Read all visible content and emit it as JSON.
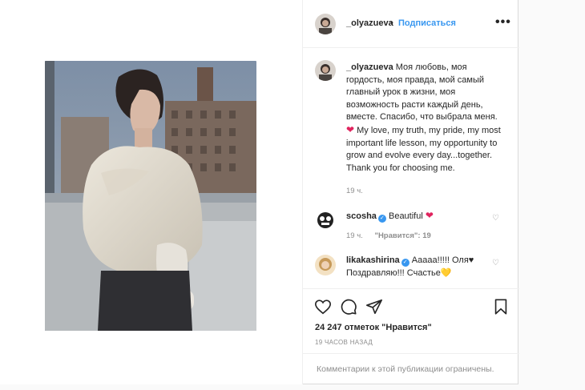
{
  "header": {
    "username": "_olyazueva",
    "dot": "•",
    "follow_label": "Подписаться",
    "more_label": "•••"
  },
  "caption": {
    "username": "_olyazueva",
    "text_ru": "Моя любовь, моя гордость, моя правда, мой самый главный урок в жизни, моя возможность расти каждый день, вместе. Спасибо, что выбрала меня.",
    "heart": "❤",
    "text_en": "My love, my truth, my pride, my most important life lesson, my opportunity to grow and evolve every day...together. Thank you for choosing me.",
    "time": "19 ч."
  },
  "comments": [
    {
      "username": "scosha",
      "verified": "✓",
      "text": "Beautiful",
      "heart": "❤",
      "time": "19 ч.",
      "likes": "\"Нравится\": 19"
    },
    {
      "username": "likakashirina",
      "verified": "✓",
      "text": "Ааааа!!!!! Оля♥",
      "text2": "Поздравляю!!! Счастье",
      "heart": "💛"
    }
  ],
  "actions": {
    "likes": "24 247 отметок \"Нравится\"",
    "posted": "19 ЧАСОВ НАЗАД",
    "comments_closed": "Комментарии к этой публикации ограничены."
  },
  "colors": {
    "link": "#3897f0",
    "text": "#262626",
    "muted": "#8e8e8e",
    "heart": "#e0245e"
  },
  "icons": [
    "heart-outline-icon",
    "comment-icon",
    "share-icon",
    "bookmark-icon",
    "like-small-icon",
    "verified-badge-icon"
  ]
}
